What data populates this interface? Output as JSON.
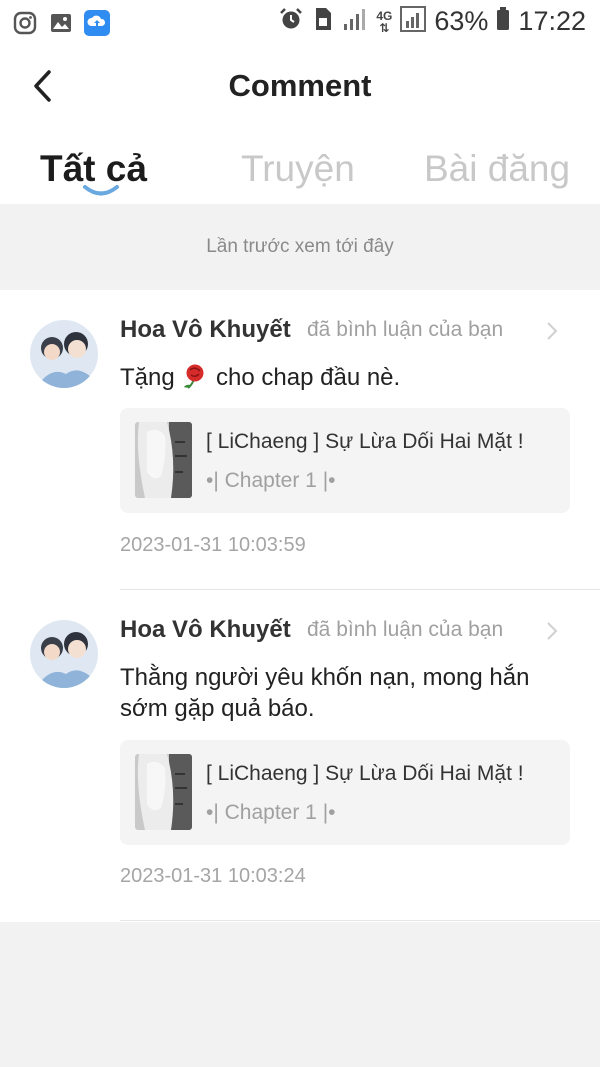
{
  "status_bar": {
    "left_icons": [
      "instagram-icon",
      "gallery-icon",
      "cloud-app-icon"
    ],
    "battery_percent": "63%",
    "network_type": "4G",
    "time": "17:22"
  },
  "header": {
    "title": "Comment"
  },
  "tabs": [
    {
      "label": "Tất cả",
      "active": true
    },
    {
      "label": "Truyện",
      "active": false
    },
    {
      "label": "Bài đăng",
      "active": false
    }
  ],
  "notice": "Lần trước xem tới đây",
  "comments": [
    {
      "user": "Hoa Vô Khuyết",
      "action": "đã bình luận của bạn",
      "text_before": "Tặng ",
      "emoji": "rose",
      "text_after": " cho chap đầu nè.",
      "story_title": "[ LiChaeng ] Sự Lừa Dối Hai Mặt !",
      "chapter": "•| Chapter 1 |•",
      "time": "2023-01-31 10:03:59"
    },
    {
      "user": "Hoa Vô Khuyết",
      "action": "đã bình luận của bạn",
      "text": "Thằng người yêu khốn nạn, mong hắn sớm gặp quả báo.",
      "story_title": "[ LiChaeng ] Sự Lừa Dối Hai Mặt !",
      "chapter": "•| Chapter 1 |•",
      "time": "2023-01-31 10:03:24"
    }
  ],
  "colors": {
    "accent": "#6aa8e0",
    "background": "#f2f2f2",
    "card": "#f4f4f4"
  }
}
